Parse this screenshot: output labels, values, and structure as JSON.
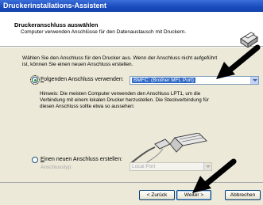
{
  "window": {
    "title": "Druckerinstallations-Assistent"
  },
  "header": {
    "title": "Druckeranschluss auswählen",
    "subtitle": "Computer verwenden Anschlüsse für den Datenaustausch mit Druckern."
  },
  "intro": [
    "Wählen Sie den Anschluss für den Drucker aus. Wenn der Anschluss nicht aufgeführt",
    "ist, können Sie einen neuen Anschluss erstellen."
  ],
  "existing_port": {
    "label_first": "F",
    "label_rest": "olgenden Anschluss verwenden:",
    "selected": true,
    "value": "BMFC: (Brother MFL Port)"
  },
  "hint": [
    "Hinweis: Die meisten Computer verwenden den Anschluss LPT1, um die",
    "Verbindung mit einem lokalen Drucker herzustellen. Die Steckverbindung für",
    "diesen Anschluss sollte etwa so aussehen:"
  ],
  "new_port": {
    "label_first": "E",
    "label_rest": "inen neuen Anschluss erstellen:",
    "selected": false,
    "type_label": "Anschlusstyp:",
    "type_value": "Local Port"
  },
  "buttons": {
    "back": "< Zurück",
    "next": "Weiter >",
    "cancel": "Abbrechen"
  },
  "colors": {
    "titlebar": "#1a4bbd",
    "selection": "#316ac5",
    "annotation_arrow": "#000000"
  },
  "icons": [
    "printer-icon",
    "parallel-cable-icon",
    "annotation-arrow"
  ]
}
